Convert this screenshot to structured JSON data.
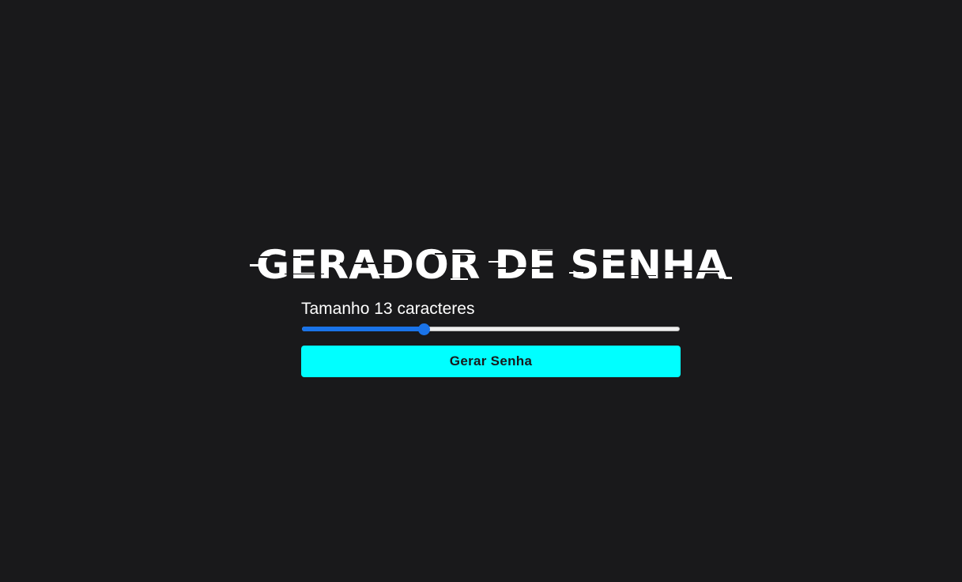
{
  "page": {
    "background_color": "#19191b"
  },
  "header": {
    "title": "GERADOR DE SENHA"
  },
  "controls": {
    "size_prefix": "Tamanho",
    "size_value": "13",
    "size_suffix": "caracteres",
    "slider": {
      "value": 13,
      "min": 4,
      "max": 32,
      "fill_color": "#1a73e8",
      "track_color": "#efefef"
    },
    "generate_button_label": "Gerar Senha",
    "generate_button_color": "#00ffff"
  }
}
